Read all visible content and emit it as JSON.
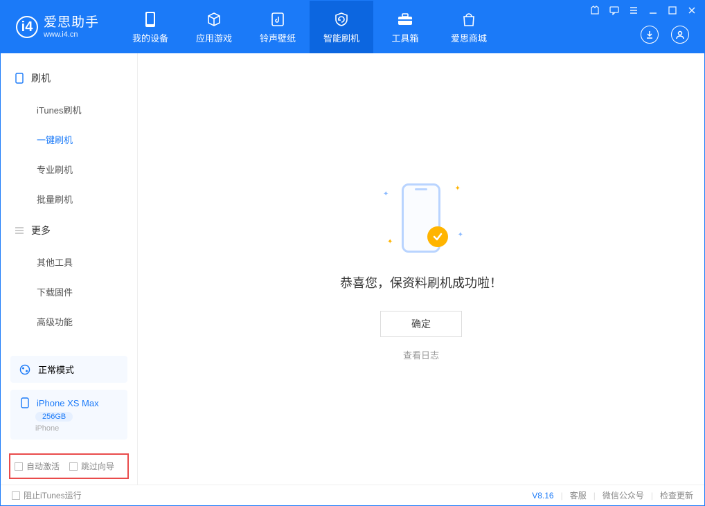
{
  "app": {
    "name": "爱思助手",
    "url": "www.i4.cn"
  },
  "nav": {
    "items": [
      {
        "label": "我的设备"
      },
      {
        "label": "应用游戏"
      },
      {
        "label": "铃声壁纸"
      },
      {
        "label": "智能刷机"
      },
      {
        "label": "工具箱"
      },
      {
        "label": "爱思商城"
      }
    ]
  },
  "sidebar": {
    "group1": {
      "title": "刷机",
      "items": [
        {
          "label": "iTunes刷机"
        },
        {
          "label": "一键刷机"
        },
        {
          "label": "专业刷机"
        },
        {
          "label": "批量刷机"
        }
      ]
    },
    "group2": {
      "title": "更多",
      "items": [
        {
          "label": "其他工具"
        },
        {
          "label": "下载固件"
        },
        {
          "label": "高级功能"
        }
      ]
    },
    "mode": "正常模式",
    "device": {
      "name": "iPhone XS Max",
      "capacity": "256GB",
      "type": "iPhone"
    },
    "options": {
      "auto_activate": "自动激活",
      "skip_guide": "跳过向导"
    }
  },
  "main": {
    "success_msg": "恭喜您，保资料刷机成功啦！",
    "ok_btn": "确定",
    "log_link": "查看日志"
  },
  "footer": {
    "block_itunes": "阻止iTunes运行",
    "version": "V8.16",
    "links": {
      "support": "客服",
      "wechat": "微信公众号",
      "update": "检查更新"
    }
  }
}
